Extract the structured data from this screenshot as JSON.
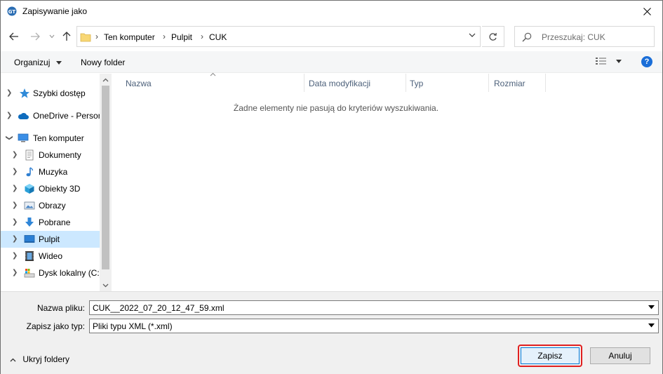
{
  "window": {
    "title": "Zapisywanie jako"
  },
  "address": {
    "breadcrumbs": [
      "Ten komputer",
      "Pulpit",
      "CUK"
    ],
    "search_placeholder": "Przeszukaj: CUK"
  },
  "toolbar": {
    "organize_label": "Organizuj",
    "new_folder_label": "Nowy folder",
    "help_label": "?"
  },
  "nav_pane": {
    "items": [
      {
        "label": "Szybki dostęp",
        "icon": "star-icon"
      },
      {
        "label": "OneDrive - Personal",
        "icon": "cloud-icon"
      },
      {
        "label": "Ten komputer",
        "icon": "computer-icon"
      },
      {
        "label": "Dokumenty",
        "icon": "documents-icon"
      },
      {
        "label": "Muzyka",
        "icon": "music-icon"
      },
      {
        "label": "Obiekty 3D",
        "icon": "cube-icon"
      },
      {
        "label": "Obrazy",
        "icon": "pictures-icon"
      },
      {
        "label": "Pobrane",
        "icon": "download-icon"
      },
      {
        "label": "Pulpit",
        "icon": "desktop-icon",
        "selected": true
      },
      {
        "label": "Wideo",
        "icon": "video-icon"
      },
      {
        "label": "Dysk lokalny (C:)",
        "icon": "drive-icon"
      }
    ]
  },
  "file_list": {
    "columns": [
      "Nazwa",
      "Data modyfikacji",
      "Typ",
      "Rozmiar"
    ],
    "empty_message": "Żadne elementy nie pasują do kryteriów wyszukiwania."
  },
  "save": {
    "filename_label": "Nazwa pliku:",
    "filename_value": "CUK__2022_07_20_12_47_59.xml",
    "filetype_label": "Zapisz jako typ:",
    "filetype_value": "Pliki typu XML (*.xml)",
    "hide_folders_label": "Ukryj foldery",
    "save_button": "Zapisz",
    "cancel_button": "Anuluj"
  },
  "colors": {
    "selection": "#cce8ff",
    "accent": "#0078d7",
    "highlight_ring": "#e02020"
  }
}
